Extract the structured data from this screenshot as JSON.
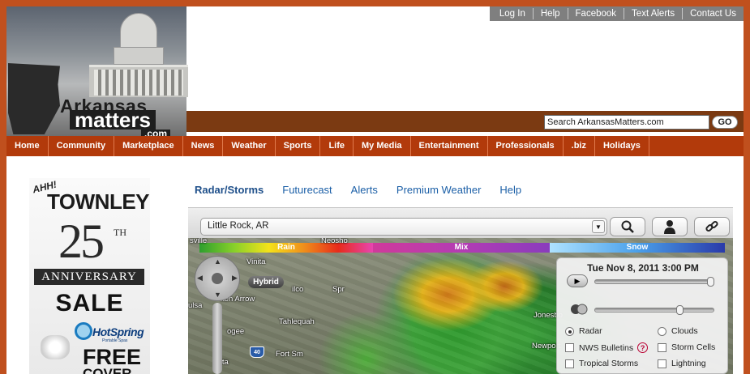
{
  "header": {
    "logo": {
      "line1": "Arkansas",
      "line2": "matters",
      "line3": ".com"
    },
    "top_links": [
      "Log In",
      "Help",
      "Facebook",
      "Text Alerts",
      "Contact Us"
    ],
    "search": {
      "value": "Search ArkansasMatters.com",
      "button": "GO"
    }
  },
  "main_nav": [
    "Home",
    "Community",
    "Marketplace",
    "News",
    "Weather",
    "Sports",
    "Life",
    "My Media",
    "Entertainment",
    "Professionals",
    ".biz",
    "Holidays"
  ],
  "ad": {
    "ahh": "AHH!",
    "brand": "TOWNLEY",
    "number": "25",
    "suffix": "TH",
    "ribbon": "ANNIVERSARY",
    "sale": "SALE",
    "partner": "HotSpring",
    "partner_sub": "Portable Spas",
    "free": "FREE",
    "cover": "COVER"
  },
  "weather": {
    "tabs": [
      "Radar/Storms",
      "Futurecast",
      "Alerts",
      "Premium Weather",
      "Help"
    ],
    "location": "Little Rock, AR",
    "legend": {
      "rain": "Rain",
      "mix": "Mix",
      "snow": "Snow"
    },
    "map_labels": {
      "vinita": "Vinita",
      "arrow": "ken Arrow",
      "tulsa": "ulsa",
      "tahlequah": "Tahlequah",
      "ogee": "ogee",
      "fort": "Fort Sm",
      "spr": "Spr",
      "newport": "Newport",
      "neosho": "Neosho",
      "ilco": "ilco",
      "etta": "etta",
      "sville": "sville",
      "jonesboro": "Jonesbo",
      "hwy": "40"
    },
    "hybrid": "Hybrid",
    "panel": {
      "datetime": "Tue Nov 8, 2011 3:00 PM",
      "radar": "Radar",
      "clouds": "Clouds",
      "nws": "NWS Bulletins",
      "storm_cells": "Storm Cells",
      "tropical": "Tropical Storms",
      "lightning": "Lightning",
      "help": "?",
      "play": "▶"
    },
    "icons": [
      "search-icon",
      "person-icon",
      "link-icon"
    ]
  }
}
